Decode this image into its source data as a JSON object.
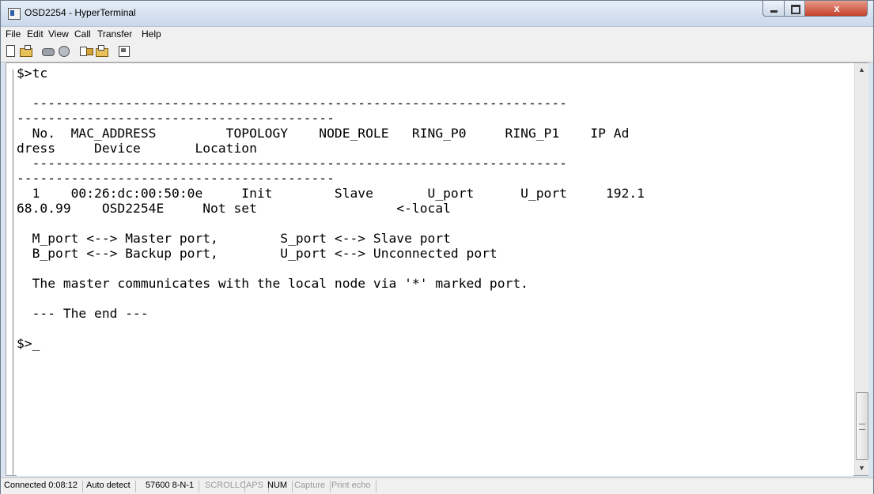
{
  "window": {
    "title": "OSD2254 - HyperTerminal",
    "close_label": "x",
    "colors": {
      "title_bar": "#c9d8ea",
      "close_button": "#c4402b"
    }
  },
  "menu": [
    "File",
    "Edit",
    "View",
    "Call",
    "Transfer",
    "Help"
  ],
  "toolbar": {
    "icons": [
      "new-document-icon",
      "open-folder-icon",
      "phone-dial-icon",
      "disconnect-icon",
      "send-file-icon",
      "receive-file-icon",
      "properties-icon"
    ]
  },
  "terminal": {
    "lines": [
      "$>tc",
      "",
      "  ---------------------------------------------------------------------",
      "-----------------------------------------",
      "  No.  MAC_ADDRESS         TOPOLOGY    NODE_ROLE   RING_P0     RING_P1    IP Ad",
      "dress     Device       Location",
      "  ---------------------------------------------------------------------",
      "-----------------------------------------",
      "  1    00:26:dc:00:50:0e     Init        Slave       U_port      U_port     192.1",
      "68.0.99    OSD2254E     Not set                  <-local",
      "",
      "  M_port <--> Master port,        S_port <--> Slave port",
      "  B_port <--> Backup port,        U_port <--> Unconnected port",
      "",
      "  The master communicates with the local node via '*' marked port.",
      "",
      "  --- The end ---",
      "",
      "$>_"
    ]
  },
  "status_bar": {
    "connected": "Connected 0:08:12",
    "emulation": "Auto detect",
    "port_settings": "57600 8-N-1",
    "scroll": "SCROLL",
    "caps": "CAPS",
    "num": "NUM",
    "capture": "Capture",
    "print_echo": "Print echo"
  }
}
